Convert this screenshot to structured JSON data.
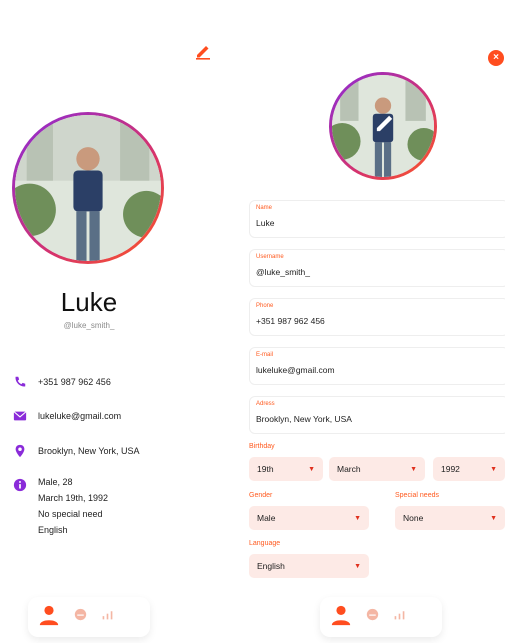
{
  "profile": {
    "name": "Luke",
    "handle": "@luke_smith_",
    "phone": "+351 987 962 456",
    "email": "lukeluke@gmail.com",
    "address": "Brooklyn, New York, USA",
    "info_lines": [
      "Male, 28",
      "March 19th, 1992",
      "No special need",
      "English"
    ]
  },
  "edit": {
    "fields": [
      {
        "label": "Name",
        "value": "Luke"
      },
      {
        "label": "Username",
        "value": "@luke_smith_"
      },
      {
        "label": "Phone",
        "value": "+351 987 962 456"
      },
      {
        "label": "E-mail",
        "value": "lukeluke@gmail.com"
      },
      {
        "label": "Adress",
        "value": "Brooklyn, New York, USA"
      }
    ],
    "birthday_label": "Birthday",
    "birthday": {
      "day": "19th",
      "month": "March",
      "year": "1992"
    },
    "gender_label": "Gender",
    "gender": "Male",
    "special_needs_label": "Special needs",
    "special_needs": "None",
    "language_label": "Language",
    "language": "English"
  },
  "colors": {
    "accent": "#ff5a1f",
    "purple": "#8a2bd9",
    "field_bg": "#fdeae6"
  },
  "icons": [
    "edit-icon",
    "close-icon",
    "phone-icon",
    "mail-icon",
    "location-icon",
    "info-icon",
    "user-icon",
    "emoji-icon",
    "stats-icon"
  ]
}
